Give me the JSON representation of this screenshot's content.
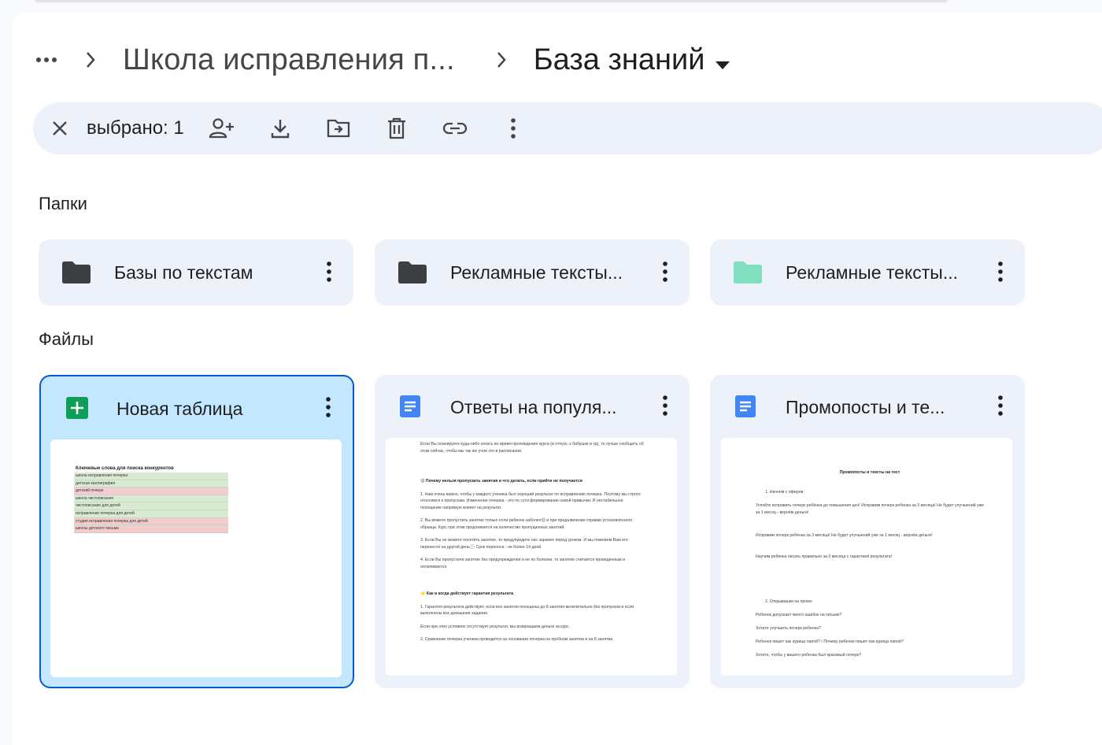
{
  "breadcrumb": {
    "parent": "Школа исправления п...",
    "current": "База знаний"
  },
  "selection": {
    "count_label": "выбрано: 1"
  },
  "sections": {
    "folders": "Папки",
    "files": "Файлы"
  },
  "folders": [
    {
      "name": "Базы по текстам",
      "color": "#3c4043"
    },
    {
      "name": "Рекламные тексты...",
      "color": "#3c4043"
    },
    {
      "name": "Рекламные тексты...",
      "color": "#81dfbf"
    }
  ],
  "files": [
    {
      "name": "Новая таблица",
      "type": "sheet"
    },
    {
      "name": "Ответы на популя...",
      "type": "doc"
    },
    {
      "name": "Промопосты и те...",
      "type": "doc"
    }
  ],
  "thumb_sheet": {
    "header": "Ключевые слова для поиска конкурентов",
    "rows": [
      {
        "t": "школа исправления почерка",
        "c": "g"
      },
      {
        "t": "детская каллиграфия",
        "c": "g"
      },
      {
        "t": "детский почерк",
        "c": "r"
      },
      {
        "t": "школа чистописания",
        "c": "g"
      },
      {
        "t": "чистописание для детей",
        "c": "g"
      },
      {
        "t": "исправление почерка для детей",
        "c": "g"
      },
      {
        "t": "студия исправления почерка для детей",
        "c": "r"
      },
      {
        "t": "школы детского письма",
        "c": "r"
      }
    ]
  },
  "thumb_doc1": {
    "p1": "Если Вы планируете куда-либо уехать во время прохождения курса (в отпуск, к бабушке и тд), то лучше сообщить об этом сейчас, чтобы мы так же учли это в расписании.",
    "h1": "😊 Почему нельзя пропускать занятия и что делать, если прийти не получается",
    "p2": "1. Нам очень важно, чтобы у каждого ученика был хороший результат по исправлению почерка. Поэтому мы строго относимся к пропускам. Изменение почерка - это по сути формирование новой привычки. И нестабильное посещение напрямую влияет на результат.",
    "p3": "2. Вы можете пропустить занятие только если ребенок заболел😌 и при предъявлении справки установленного образца. Курс при этом продлевается на количество пропущенных занятий.",
    "p4": "3. Если Вы не можете посетить занятие, то предупредите нас заранее перед уроком. И мы поможем Вам его перенести на другой день🕐 Срок переноса - не более 14 дней.",
    "p5": "4. Если Вы пропустили занятие без предупреждения и не по болезни, то занятие считается проведенным и оплачивается.",
    "h2": "⭐ Как и когда действует гарантия результата",
    "p6": "1. Гарантия результата действует, если все занятия посещены до 8 занятия включительно без пропусков и если выполнены все домашние задания.",
    "p7": "Если при этих условиях отсутствует результат, мы возвращаем деньги за курс.",
    "p8": "2. Сравнение почерка ученика проводится на основании почерка на пробном занятии и на 8 занятии."
  },
  "thumb_doc2": {
    "title": "Промопосты и тексты на тест",
    "s1": "1. Начнем с оферов",
    "p1": "Успейте исправить почерк ребёнка до повышения цен! Исправим почерк ребенка за 3 месяца! Не будет улучшений уже за 1 месяц - вернём деньги!",
    "p2": "Исправим почерк ребенка за 3 месяца! Не будет улучшений уже за 1 месяц - вернём деньги!",
    "p3": "Научим ребенка писать правильно за 3 месяца с гарантией результата!",
    "s2": "2. Открывашки на промо",
    "p4": "Ребенок допускает много ошибок на письме?",
    "p5": "Хотите улучшить почерк ребенка?",
    "p6": "Ребенок пишет как курица лапой? / Почему ребенок пишет как курица лапой?",
    "p7": "Хотите, чтобы у вашего ребенка был красивый почерк?"
  }
}
